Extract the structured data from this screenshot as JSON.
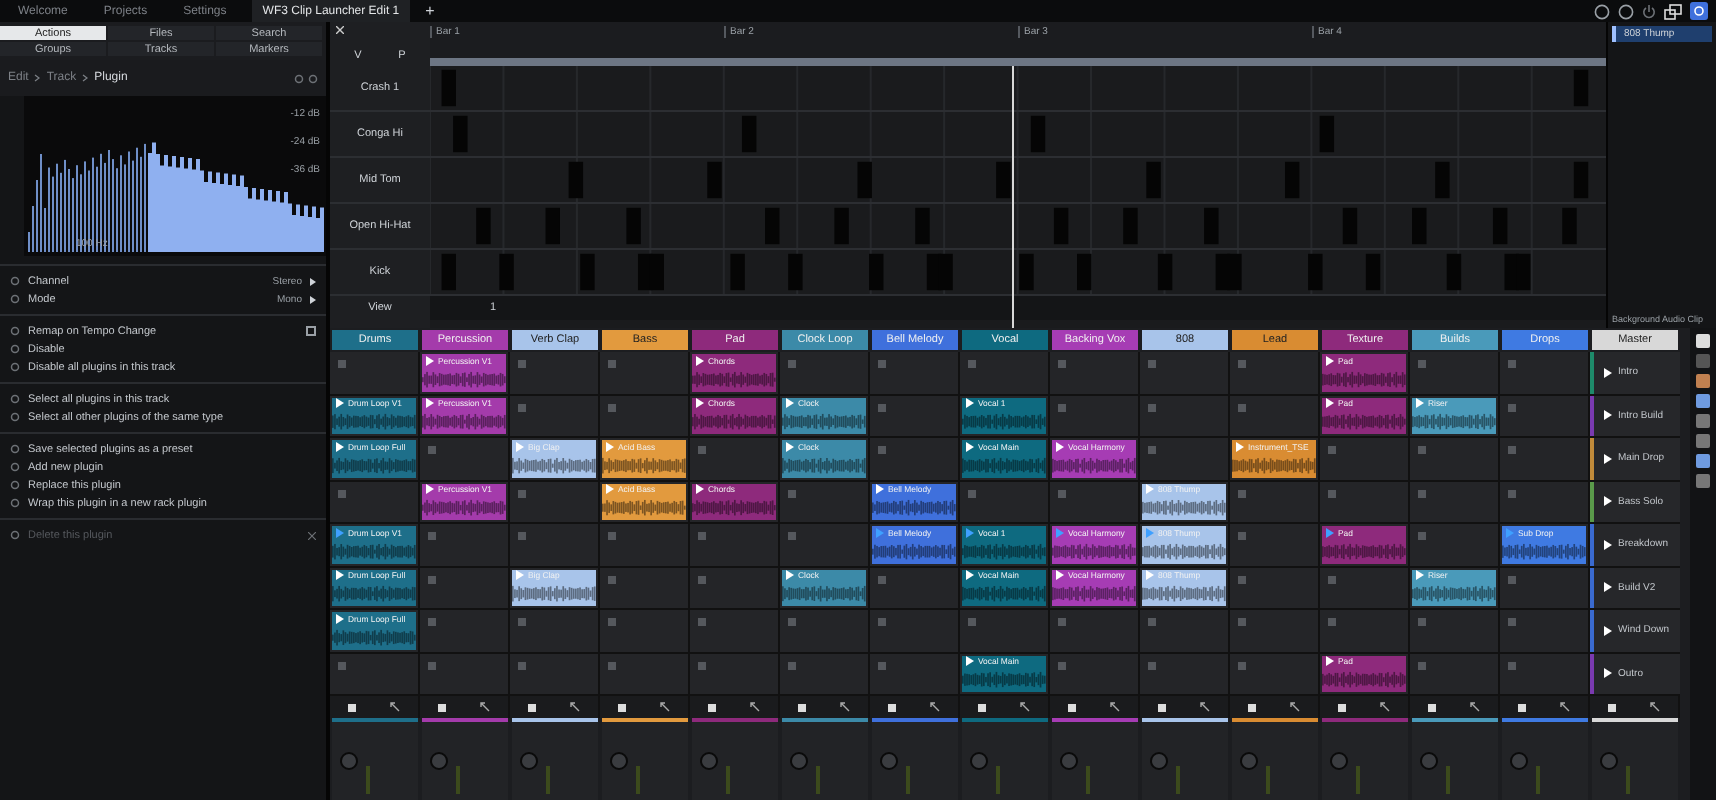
{
  "top_tabs": [
    {
      "label": "Welcome",
      "selected": false
    },
    {
      "label": "Projects",
      "selected": false
    },
    {
      "label": "Settings",
      "selected": false
    },
    {
      "label": "WF3 Clip Launcher Edit 1",
      "selected": true
    }
  ],
  "new_tab": "+",
  "browser_tabs": [
    {
      "label": "Actions",
      "selected": true
    },
    {
      "label": "Files",
      "selected": false
    },
    {
      "label": "Search",
      "selected": false
    },
    {
      "label": "Groups",
      "selected": false
    },
    {
      "label": "Tracks",
      "selected": false
    },
    {
      "label": "Markers",
      "selected": false
    }
  ],
  "breadcrumb": [
    "Edit",
    "Track",
    "Plugin"
  ],
  "spectrum": {
    "db_labels": [
      "-12 dB",
      "-24 dB",
      "-36 dB"
    ],
    "freq_label": "100 Hz"
  },
  "plugin_menu": [
    [
      {
        "kind": "value",
        "label": "Channel",
        "value": "Stereo"
      },
      {
        "kind": "value",
        "label": "Mode",
        "value": "Mono"
      }
    ],
    [
      {
        "kind": "checkbox",
        "label": "Remap on Tempo Change",
        "checked": false
      },
      {
        "kind": "action",
        "label": "Disable",
        "disabled": false
      },
      {
        "kind": "action",
        "label": "Disable all plugins in this track",
        "disabled": false
      }
    ],
    [
      {
        "kind": "action",
        "label": "Select all plugins in this track",
        "disabled": false
      },
      {
        "kind": "action",
        "label": "Select all other plugins of the same type",
        "disabled": false
      }
    ],
    [
      {
        "kind": "action",
        "label": "Save selected plugins as a preset",
        "disabled": false
      },
      {
        "kind": "action",
        "label": "Add new plugin",
        "disabled": false
      },
      {
        "kind": "action",
        "label": "Replace this plugin",
        "disabled": false
      },
      {
        "kind": "action",
        "label": "Wrap this plugin in a new rack plugin",
        "disabled": false
      }
    ],
    [
      {
        "kind": "action",
        "label": "Delete this plugin",
        "disabled": true
      }
    ]
  ],
  "piano_roll": {
    "columns": [
      "V",
      "P"
    ],
    "bars": [
      "Bar 1",
      "Bar 2",
      "Bar 3",
      "Bar 4"
    ],
    "rows": [
      "Crash 1",
      "Conga Hi",
      "Mid Tom",
      "Open Hi-Hat",
      "Kick"
    ],
    "view_label": "View",
    "view_value": "1"
  },
  "clip_list": {
    "items": [
      {
        "label": "808 Thump",
        "selected": true
      }
    ],
    "footer": "Background Audio Clip"
  },
  "tracks": [
    {
      "name": "Drums",
      "color": "#1e6f8a",
      "slots": [
        {
          "kind": "empty"
        },
        {
          "kind": "clip",
          "name": "Drum Loop V1",
          "playing": false
        },
        {
          "kind": "clip",
          "name": "Drum Loop Full",
          "playing": false
        },
        {
          "kind": "empty"
        },
        {
          "kind": "clip",
          "name": "Drum Loop V1",
          "playing": true
        },
        {
          "kind": "clip",
          "name": "Drum Loop Full",
          "playing": false
        },
        {
          "kind": "clip",
          "name": "Drum Loop Full",
          "playing": false
        },
        {
          "kind": "empty"
        }
      ]
    },
    {
      "name": "Percussion",
      "color": "#a43bab",
      "slots": [
        {
          "kind": "clip",
          "name": "Percussion V1",
          "playing": false
        },
        {
          "kind": "clip",
          "name": "Percussion V1",
          "playing": false
        },
        {
          "kind": "empty"
        },
        {
          "kind": "clip",
          "name": "Percussion V1",
          "playing": false
        },
        {
          "kind": "empty"
        },
        {
          "kind": "empty"
        },
        {
          "kind": "empty"
        },
        {
          "kind": "empty"
        }
      ]
    },
    {
      "name": "Verb Clap",
      "color": "#a8c4ea",
      "slots": [
        {
          "kind": "empty"
        },
        {
          "kind": "empty"
        },
        {
          "kind": "clip",
          "name": "Big Clap",
          "playing": false
        },
        {
          "kind": "empty"
        },
        {
          "kind": "empty"
        },
        {
          "kind": "clip",
          "name": "Big Clap",
          "playing": false
        },
        {
          "kind": "empty"
        },
        {
          "kind": "empty"
        }
      ]
    },
    {
      "name": "Bass",
      "color": "#e29a3e",
      "slots": [
        {
          "kind": "empty"
        },
        {
          "kind": "empty"
        },
        {
          "kind": "clip",
          "name": "Acid Bass",
          "playing": false
        },
        {
          "kind": "clip",
          "name": "Acid Bass",
          "playing": false
        },
        {
          "kind": "empty"
        },
        {
          "kind": "empty"
        },
        {
          "kind": "empty"
        },
        {
          "kind": "empty"
        }
      ]
    },
    {
      "name": "Pad",
      "color": "#8e2a7c",
      "slots": [
        {
          "kind": "clip",
          "name": "Chords",
          "playing": false
        },
        {
          "kind": "clip",
          "name": "Chords",
          "playing": false
        },
        {
          "kind": "empty"
        },
        {
          "kind": "clip",
          "name": "Chords",
          "playing": false
        },
        {
          "kind": "empty"
        },
        {
          "kind": "empty"
        },
        {
          "kind": "empty"
        },
        {
          "kind": "empty"
        }
      ]
    },
    {
      "name": "Clock Loop",
      "color": "#3c8aa8",
      "slots": [
        {
          "kind": "empty"
        },
        {
          "kind": "clip",
          "name": "Clock",
          "playing": false
        },
        {
          "kind": "clip",
          "name": "Clock",
          "playing": false
        },
        {
          "kind": "empty"
        },
        {
          "kind": "empty"
        },
        {
          "kind": "clip",
          "name": "Clock",
          "playing": false
        },
        {
          "kind": "empty"
        },
        {
          "kind": "empty"
        }
      ]
    },
    {
      "name": "Bell Melody",
      "color": "#3f70dc",
      "slots": [
        {
          "kind": "empty"
        },
        {
          "kind": "empty"
        },
        {
          "kind": "empty"
        },
        {
          "kind": "clip",
          "name": "Bell Melody",
          "playing": false
        },
        {
          "kind": "clip",
          "name": "Bell Melody",
          "playing": true
        },
        {
          "kind": "empty"
        },
        {
          "kind": "empty"
        },
        {
          "kind": "empty"
        }
      ]
    },
    {
      "name": "Vocal",
      "color": "#0e6a80",
      "slots": [
        {
          "kind": "empty"
        },
        {
          "kind": "clip",
          "name": "Vocal 1",
          "playing": false
        },
        {
          "kind": "clip",
          "name": "Vocal Main",
          "playing": false
        },
        {
          "kind": "empty"
        },
        {
          "kind": "clip",
          "name": "Vocal 1",
          "playing": true
        },
        {
          "kind": "clip",
          "name": "Vocal Main",
          "playing": false
        },
        {
          "kind": "empty"
        },
        {
          "kind": "clip",
          "name": "Vocal Main",
          "playing": false
        }
      ]
    },
    {
      "name": "Backing Vox",
      "color": "#a63cb4",
      "slots": [
        {
          "kind": "empty"
        },
        {
          "kind": "empty"
        },
        {
          "kind": "clip",
          "name": "Vocal Harmony",
          "playing": false
        },
        {
          "kind": "empty"
        },
        {
          "kind": "clip",
          "name": "Vocal Harmony",
          "playing": true
        },
        {
          "kind": "clip",
          "name": "Vocal Harmony",
          "playing": false
        },
        {
          "kind": "empty"
        },
        {
          "kind": "empty"
        }
      ]
    },
    {
      "name": "808",
      "color": "#a8c4ea",
      "slots": [
        {
          "kind": "empty"
        },
        {
          "kind": "empty"
        },
        {
          "kind": "empty"
        },
        {
          "kind": "clip",
          "name": "808 Thump",
          "playing": false
        },
        {
          "kind": "clip",
          "name": "808 Thump",
          "playing": true
        },
        {
          "kind": "clip",
          "name": "808 Thump",
          "playing": false
        },
        {
          "kind": "empty"
        },
        {
          "kind": "empty"
        }
      ]
    },
    {
      "name": "Lead",
      "color": "#d98c32",
      "slots": [
        {
          "kind": "empty"
        },
        {
          "kind": "empty"
        },
        {
          "kind": "clip",
          "name": "Instrument_TSE",
          "playing": false
        },
        {
          "kind": "empty"
        },
        {
          "kind": "empty"
        },
        {
          "kind": "empty"
        },
        {
          "kind": "empty"
        },
        {
          "kind": "empty"
        }
      ]
    },
    {
      "name": "Texture",
      "color": "#8e2a7c",
      "slots": [
        {
          "kind": "clip",
          "name": "Pad",
          "playing": false
        },
        {
          "kind": "clip",
          "name": "Pad",
          "playing": false
        },
        {
          "kind": "empty"
        },
        {
          "kind": "empty"
        },
        {
          "kind": "clip",
          "name": "Pad",
          "playing": true
        },
        {
          "kind": "empty"
        },
        {
          "kind": "empty"
        },
        {
          "kind": "clip",
          "name": "Pad",
          "playing": false
        }
      ]
    },
    {
      "name": "Builds",
      "color": "#4a9aba",
      "slots": [
        {
          "kind": "empty"
        },
        {
          "kind": "clip",
          "name": "Riser",
          "playing": false
        },
        {
          "kind": "empty"
        },
        {
          "kind": "empty"
        },
        {
          "kind": "empty"
        },
        {
          "kind": "clip",
          "name": "Riser",
          "playing": false
        },
        {
          "kind": "empty"
        },
        {
          "kind": "empty"
        }
      ]
    },
    {
      "name": "Drops",
      "color": "#3f7ae2",
      "slots": [
        {
          "kind": "empty"
        },
        {
          "kind": "empty"
        },
        {
          "kind": "empty"
        },
        {
          "kind": "empty"
        },
        {
          "kind": "clip",
          "name": "Sub Drop",
          "playing": true
        },
        {
          "kind": "empty"
        },
        {
          "kind": "empty"
        },
        {
          "kind": "empty"
        }
      ]
    }
  ],
  "master": {
    "name": "Master",
    "scenes": [
      {
        "name": "Intro",
        "color": "#1e8a6a"
      },
      {
        "name": "Intro Build",
        "color": "#7a3ab0"
      },
      {
        "name": "Main Drop",
        "color": "#c08a3a"
      },
      {
        "name": "Bass Solo",
        "color": "#5a9a4a"
      },
      {
        "name": "Breakdown",
        "color": "#3a6ad0"
      },
      {
        "name": "Build V2",
        "color": "#3a6ad0"
      },
      {
        "name": "Wind Down",
        "color": "#3a6ad0"
      },
      {
        "name": "Outro",
        "color": "#7a3ab0"
      }
    ]
  }
}
